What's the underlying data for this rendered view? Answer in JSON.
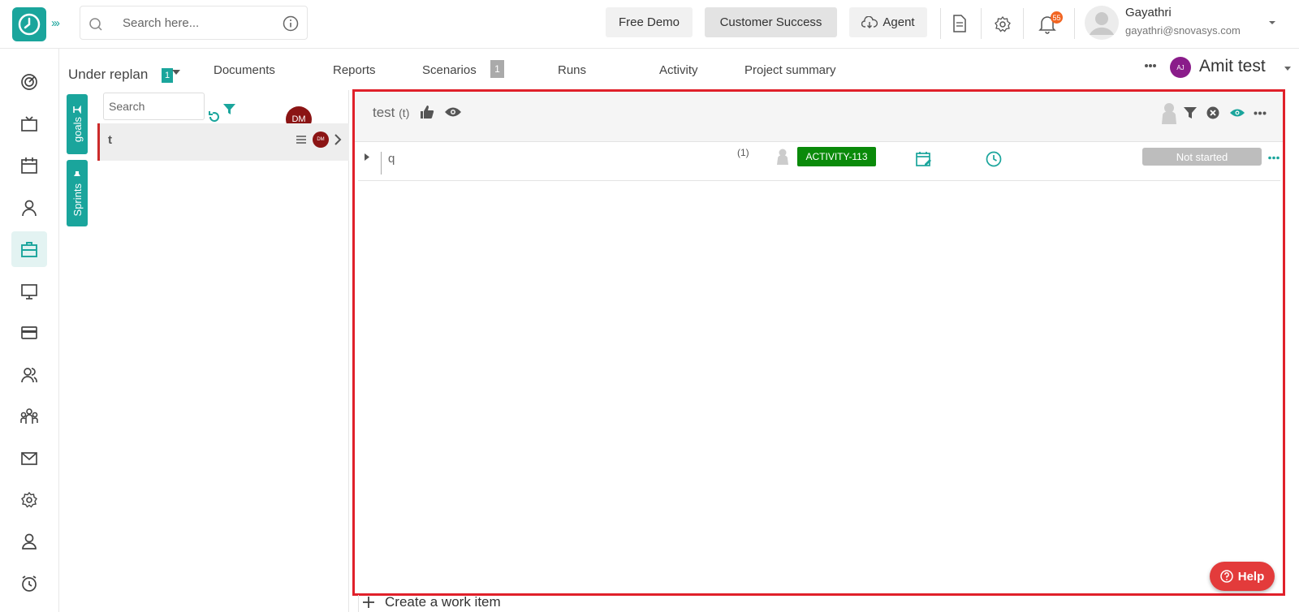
{
  "header": {
    "search_placeholder": "Search here...",
    "free_demo": "Free Demo",
    "customer_success": "Customer Success",
    "agent": "Agent",
    "notification_count": "55",
    "user": {
      "name": "Gayathri",
      "email": "gayathri@snovasys.com"
    },
    "accent_color": "#1aa59c"
  },
  "nav": {
    "items": [
      "dashboard-icon",
      "tv-icon",
      "calendar-icon",
      "user-icon",
      "briefcase-icon",
      "monitor-icon",
      "card-icon",
      "users-icon",
      "team-icon",
      "mail-icon",
      "settings-icon",
      "profile-icon",
      "alarm-icon"
    ],
    "active": "briefcase-icon"
  },
  "subheader": {
    "under_replan": "Under replan",
    "under_replan_count": "1",
    "tabs": [
      "Documents",
      "Reports",
      "Scenarios",
      "Runs",
      "Activity",
      "Project summary"
    ],
    "scenarios_count": "1",
    "project_initials": "AJ",
    "project_name": "Amit test"
  },
  "side_tabs": {
    "goals": "goals",
    "sprints": "Sprints"
  },
  "goals_panel": {
    "search_placeholder": "Search",
    "owner_initials": "DM",
    "goal": {
      "label": "t",
      "owner_initials": "DM"
    }
  },
  "main": {
    "goal_title": "test",
    "goal_tag": "(t)",
    "task": {
      "name": "q",
      "count": "(1)",
      "activity_id": "ACTIVITY-113",
      "status": "Not started"
    },
    "create_work_item": "Create a work item"
  },
  "help": {
    "label": "Help"
  }
}
